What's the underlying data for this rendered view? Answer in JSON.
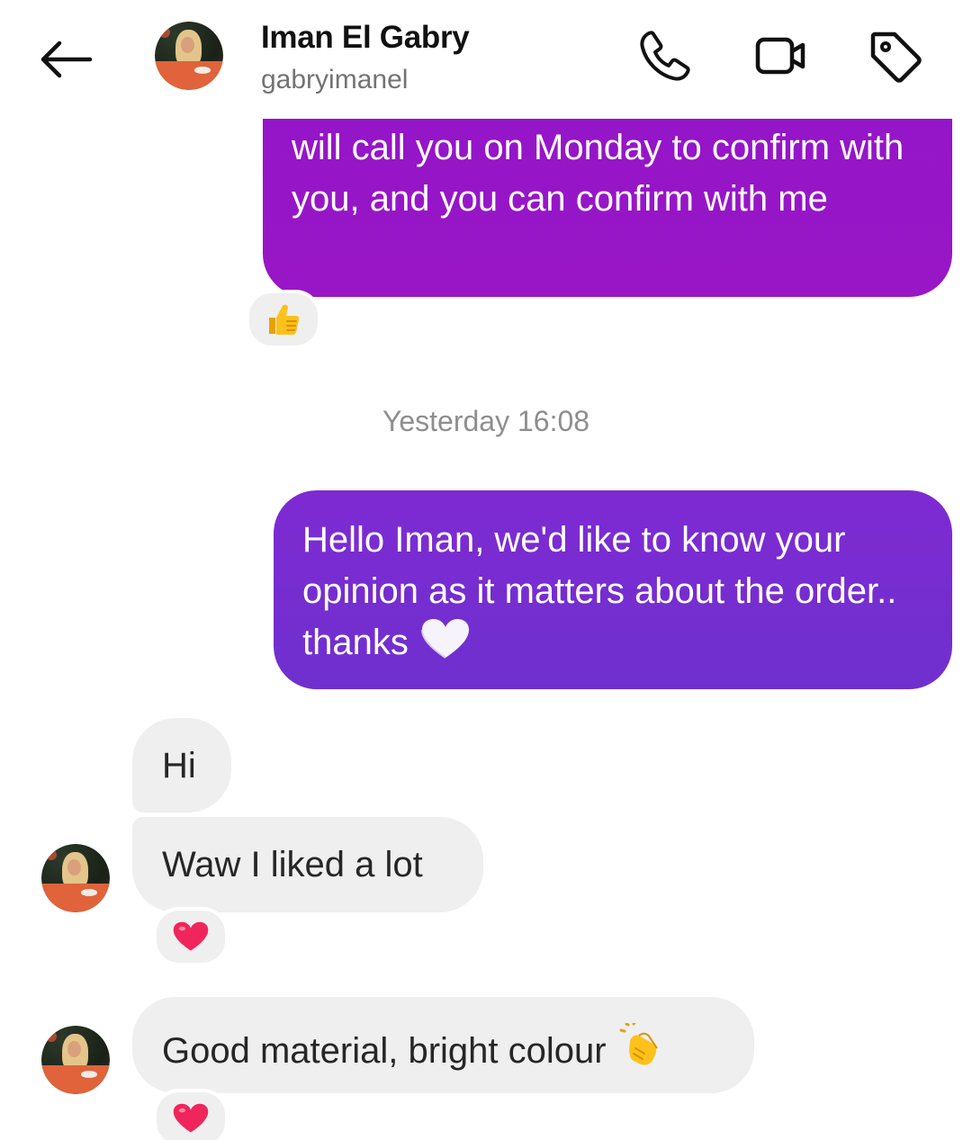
{
  "header": {
    "contact_name": "Iman El Gabry",
    "contact_handle": "gabryimanel",
    "icons": [
      "back-arrow-icon",
      "phone-icon",
      "video-camera-icon",
      "tag-icon"
    ]
  },
  "conversation": {
    "outgoing_1": {
      "text": "will call you on Monday to confirm with you, and you can confirm with me",
      "reaction": "thumbs-up"
    },
    "timestamp": "Yesterday 16:08",
    "outgoing_2": {
      "text": "Hello Iman, we'd like to know your opinion as it matters about the order.. thanks",
      "emoji": "white-heart"
    },
    "incoming": [
      {
        "text": "Hi"
      },
      {
        "text": "Waw I liked a lot",
        "reaction": "red-heart"
      },
      {
        "text": "Good material, bright colour",
        "emoji": "clapping-hands",
        "reaction": "red-heart"
      }
    ]
  },
  "colors": {
    "outgoing_bubble_top": "#9415c8",
    "outgoing_bubble_bottom": "#6f30cf",
    "incoming_bubble": "#efefef",
    "timestamp_text": "#8e8e8e"
  }
}
